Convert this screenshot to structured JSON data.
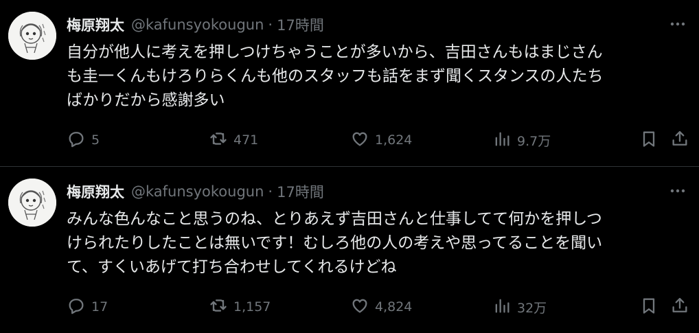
{
  "tweets": [
    {
      "author": {
        "name": "梅原翔太",
        "handle": "@kafunsyokougun"
      },
      "time": "17時間",
      "separator": "·",
      "text": "自分が他人に考えを押しつけちゃうことが多いから、吉田さんもはまじさん\nも圭一くんもけろりらくんも他のスタッフも話をまず聞くスタンスの人たち\nばかりだから感謝多い",
      "stats": {
        "replies": "5",
        "reposts": "471",
        "likes": "1,624",
        "views": "9.7万"
      }
    },
    {
      "author": {
        "name": "梅原翔太",
        "handle": "@kafunsyokougun"
      },
      "time": "17時間",
      "separator": "·",
      "text": "みんな色んなこと思うのね、とりあえず吉田さんと仕事してて何かを押しつ\nけられたりしたことは無いです！むしろ他の人の考えや思ってることを聞い\nて、すくいあげて打ち合わせしてくれるけどね",
      "stats": {
        "replies": "17",
        "reposts": "1,157",
        "likes": "4,824",
        "views": "32万"
      }
    }
  ],
  "colors": {
    "background": "#000000",
    "text": "#e7e9ea",
    "muted": "#71767b",
    "divider": "#2f3336"
  },
  "icons": [
    "avatar",
    "more-icon",
    "reply-icon",
    "repost-icon",
    "like-icon",
    "views-icon",
    "bookmark-icon",
    "share-icon"
  ]
}
